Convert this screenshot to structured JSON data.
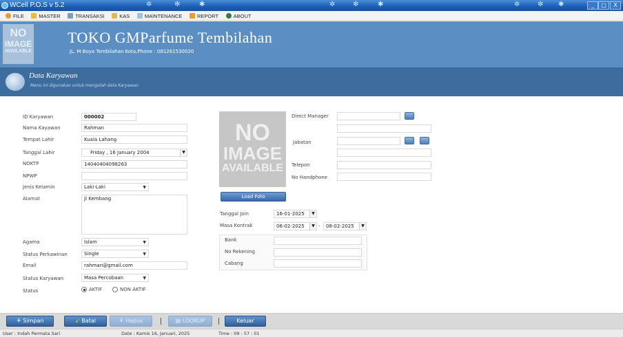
{
  "window": {
    "title": "WCell P.O.S v 5.2",
    "controls": [
      "_",
      "□",
      "X"
    ]
  },
  "menu": [
    {
      "label": "FILE",
      "icon": "file-icon"
    },
    {
      "label": "MASTER",
      "icon": "folder-icon"
    },
    {
      "label": "TRANSAKSI",
      "icon": "transaction-icon"
    },
    {
      "label": "KAS",
      "icon": "cash-icon"
    },
    {
      "label": "MAINTENANCE",
      "icon": "maintenance-icon"
    },
    {
      "label": "REPORT",
      "icon": "report-icon"
    },
    {
      "label": "ABOUT",
      "icon": "about-icon"
    }
  ],
  "header": {
    "logo_line1": "NO",
    "logo_line2": "IMAGE",
    "logo_line3": "AVAILABLE",
    "shop_name": "TOKO GMParfume Tembilahan",
    "address": "JL. M Boya Tembilahan Kota,Phone : 081261530020"
  },
  "section": {
    "title": "Data Karyawan",
    "subtitle": "Menu ini digunakan untuk mengolah data Karyawan"
  },
  "form": {
    "id_label": "ID Karyawan",
    "id_value": "000002",
    "nama_label": "Nama Kayawan",
    "nama_value": "Rahman",
    "tempat_label": "Tempat Lahir",
    "tempat_value": "Kuala Lahang",
    "tgl_label": "Tanggal Lahir",
    "tgl_value": "Friday   , 16  January  2004",
    "noktp_label": "NOKTP",
    "noktp_value": "14040404098263",
    "npwp_label": "NPWP",
    "npwp_value": "",
    "jk_label": "Jenis Kelamin",
    "jk_value": "Laki-Laki",
    "alamat_label": "Alamat",
    "alamat_value": "Jl Kembang",
    "agama_label": "Agama",
    "agama_value": "Islam",
    "kawin_label": "Status Perkawinan",
    "kawin_value": "Single",
    "email_label": "Email",
    "email_value": "rahman@gmail.com",
    "statuskar_label": "Status Karyawan",
    "statuskar_value": "Masa Percobaan",
    "status_label": "Status",
    "status_aktif": "AKTIF",
    "status_nonaktif": "NON AKTIF",
    "photo_line1": "NO",
    "photo_line2": "IMAGE",
    "photo_line3": "AVAILABLE",
    "load_foto": "Load Foto",
    "manager_label": "Direct Manager",
    "jabatan_label": "Jabatan",
    "telepon_label": "Telepon",
    "hp_label": "No Handphone",
    "join_label": "Tanggal Join",
    "join_value": "16-01-2025",
    "kontrak_label": "Masa Kontrak",
    "kontrak_from": "06-02-2025",
    "kontrak_dash": "-",
    "kontrak_to": "08-02-2025",
    "bank_label": "Bank",
    "rekening_label": "No Rekening",
    "cabang_label": "Cabang"
  },
  "toolbar": {
    "simpan": "Simpan",
    "batal": "Batal",
    "hapus": "Hapus",
    "lookup": "LOOKUP",
    "keluar": "Keluar"
  },
  "status": {
    "user": "User : Indah Permata Sari",
    "date": "Date : Kamis 16, Januari, 2025",
    "time": "Time : 09 : 57 : 01"
  },
  "colors": {
    "titlebar": "#1e5fb8",
    "header": "#5b8fc3",
    "section": "#3d6d9f",
    "button": "#3669a6"
  }
}
